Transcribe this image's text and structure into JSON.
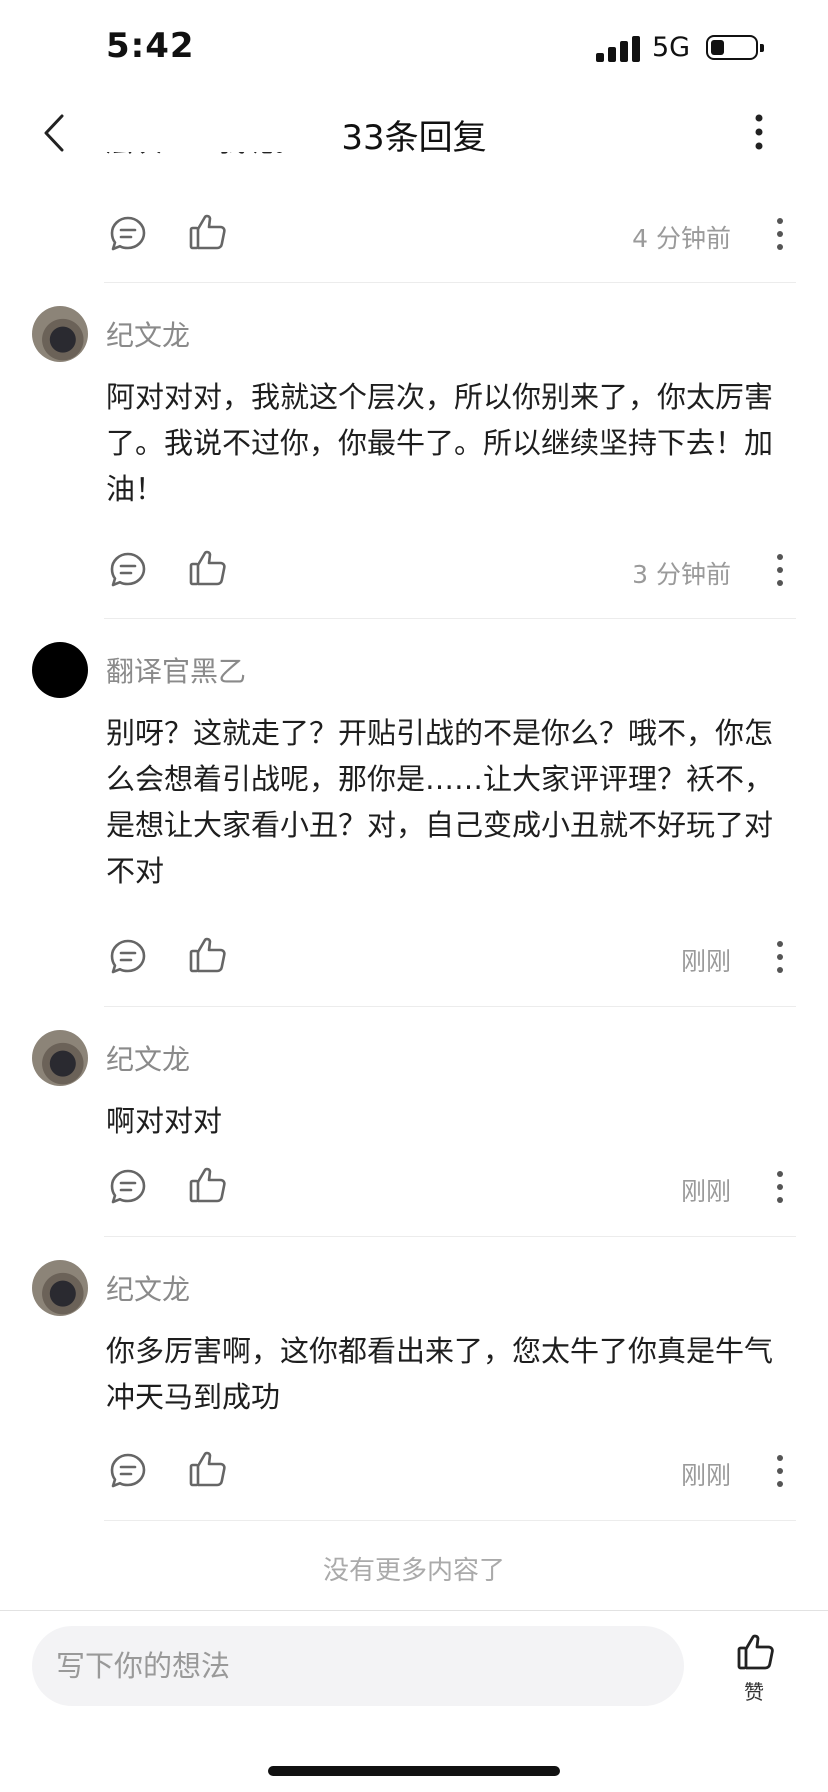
{
  "status": {
    "time": "5:42",
    "network": "5G"
  },
  "header": {
    "title": "33条回复"
  },
  "partial_comment": {
    "content": "层次……我呢。",
    "time": "4 分钟前"
  },
  "comments": [
    {
      "author": "纪文龙",
      "content": "阿对对对，我就这个层次，所以你别来了，你太厉害了。我说不过你，你最牛了。所以继续坚持下去！加油！",
      "time": "3 分钟前"
    },
    {
      "author": "翻译官黑乙",
      "content": "别呀？这就走了？开贴引战的不是你么？哦不，你怎么会想着引战呢，那你是……让大家评评理？袄不，是想让大家看小丑？对，自己变成小丑就不好玩了对不对",
      "time": "刚刚"
    },
    {
      "author": "纪文龙",
      "content": "啊对对对",
      "time": "刚刚"
    },
    {
      "author": "纪文龙",
      "content": "你多厉害啊，这你都看出来了，您太牛了你真是牛气冲天马到成功",
      "time": "刚刚"
    }
  ],
  "footer": {
    "no_more": "没有更多内容了",
    "input_placeholder": "写下你的想法",
    "like_label": "赞"
  },
  "colors": {
    "meta_gray": "#9a9a9a",
    "text": "#1e1e1e",
    "input_bg": "#f3f3f5"
  }
}
